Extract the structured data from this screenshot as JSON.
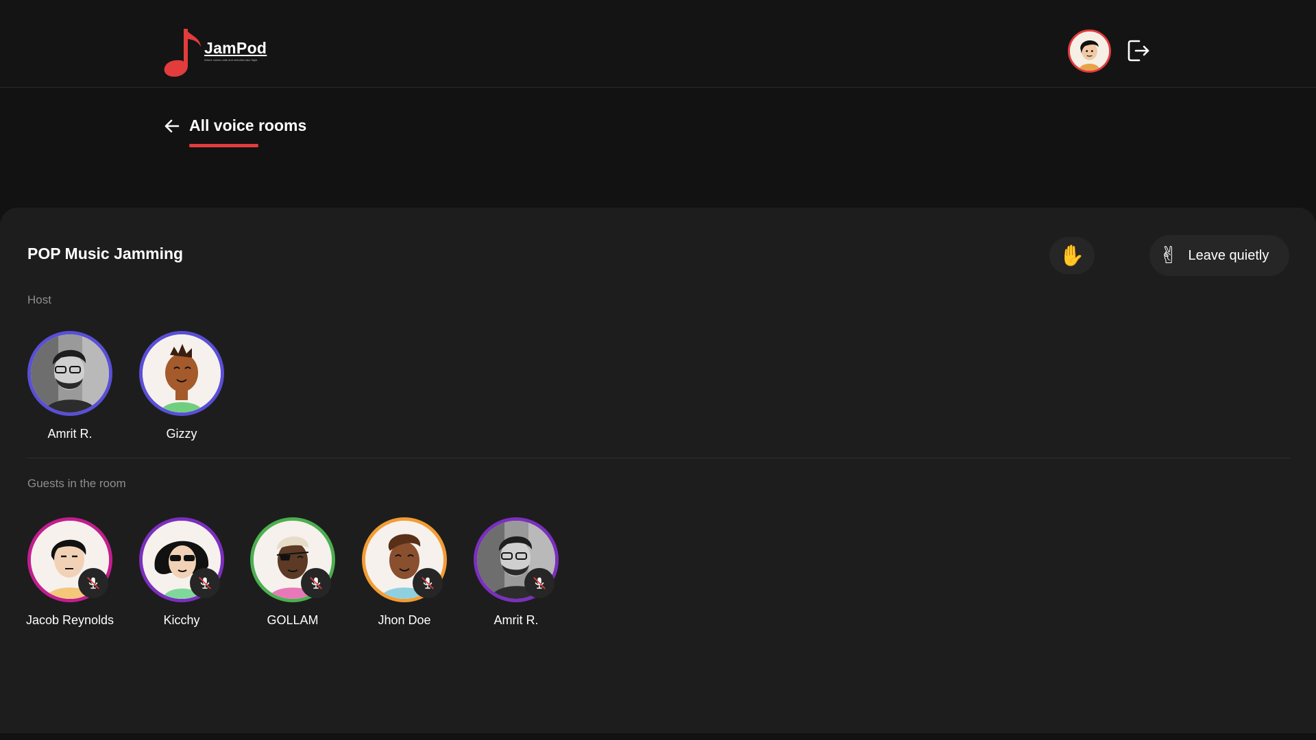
{
  "header": {
    "logo_title": "JamPod",
    "logo_tagline": "Where voices unite and melodies take flight.",
    "logo_icon": "music-note-icon",
    "profile_avatar": "user-avatar",
    "logout_icon": "logout-icon"
  },
  "nav": {
    "back_label": "All voice rooms",
    "back_icon": "arrow-left-icon"
  },
  "room": {
    "title": "POP Music Jamming",
    "raise_hand_emoji": "✋",
    "leave_emoji": "✌",
    "leave_label": "Leave quietly",
    "hosts_label": "Host",
    "guests_label": "Guests in the room",
    "hosts": [
      {
        "name": "Amrit R.",
        "ring": "#5a4fd6",
        "type": "photo"
      },
      {
        "name": "Gizzy",
        "ring": "#5a4fd6",
        "type": "cartoon-brown"
      }
    ],
    "guests": [
      {
        "name": "Jacob Reynolds",
        "ring": "#c21e8f",
        "muted": true
      },
      {
        "name": "Kicchy",
        "ring": "#7b2fbf",
        "muted": true
      },
      {
        "name": "GOLLAM",
        "ring": "#4caf50",
        "muted": true
      },
      {
        "name": "Jhon Doe",
        "ring": "#f39c34",
        "muted": true
      },
      {
        "name": "Amrit R.",
        "ring": "#7b2fbf",
        "muted": true
      }
    ]
  },
  "colors": {
    "accent": "#e23c3c",
    "background": "#121212",
    "panel": "#1d1d1d"
  }
}
